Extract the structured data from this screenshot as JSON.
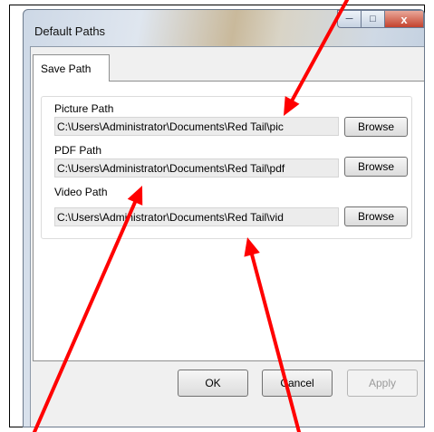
{
  "window": {
    "title": "Default Paths",
    "min_icon": "minimize-icon",
    "max_icon": "maximize-icon",
    "close_icon": "close-icon"
  },
  "tabs": [
    {
      "label": "Save Path",
      "selected": true
    }
  ],
  "paths": [
    {
      "label": "Picture Path",
      "value": "C:\\Users\\Administrator\\Documents\\Red Tail\\pic",
      "button": "Browse"
    },
    {
      "label": "PDF Path",
      "value": "C:\\Users\\Administrator\\Documents\\Red Tail\\pdf",
      "button": "Browse"
    },
    {
      "label": "Video Path",
      "value": "C:\\Users\\Administrator\\Documents\\Red Tail\\vid",
      "button": "Browse"
    }
  ],
  "buttons": {
    "ok": "OK",
    "cancel": "Cancel",
    "apply": "Apply"
  },
  "annotation_color": "#ff0000"
}
